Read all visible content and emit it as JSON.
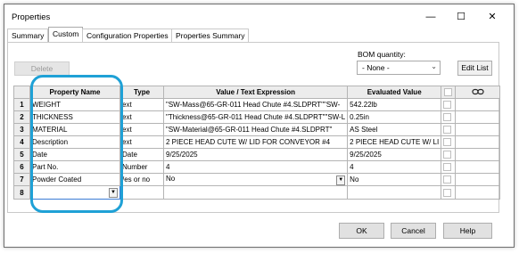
{
  "window": {
    "title": "Properties",
    "minimize": "—",
    "maximize": "☐",
    "close": "✕"
  },
  "tabs": [
    {
      "label": "Summary"
    },
    {
      "label": "Custom"
    },
    {
      "label": "Configuration Properties"
    },
    {
      "label": "Properties Summary"
    }
  ],
  "toolbar": {
    "delete_label": "Delete",
    "bom_label": "BOM quantity:",
    "bom_value": "- None -",
    "edit_list_label": "Edit List"
  },
  "table": {
    "headers": [
      "Property Name",
      "Type",
      "Value / Text Expression",
      "Evaluated Value"
    ],
    "link_icon": "link-icon",
    "rows": [
      {
        "num": "1",
        "name": "WEIGHT",
        "type": "ext",
        "value": "\"SW-Mass@65-GR-011 Head Chute #4.SLDPRT\"\"SW-",
        "evaluated": "542.22lb"
      },
      {
        "num": "2",
        "name": "THICKNESS",
        "type": "ext",
        "value": "\"Thickness@65-GR-011 Head Chute #4.SLDPRT\"\"SW-L",
        "evaluated": "0.25in"
      },
      {
        "num": "3",
        "name": "MATERIAL",
        "type": "ext",
        "value": "\"SW-Material@65-GR-011 Head Chute #4.SLDPRT\"",
        "evaluated": "AS Steel"
      },
      {
        "num": "4",
        "name": "Description",
        "type": "ext",
        "value": "2 PIECE HEAD CUTE W/ LID FOR CONVEYOR #4",
        "evaluated": "2 PIECE HEAD CUTE W/ LI"
      },
      {
        "num": "5",
        "name": "Date",
        "type": "Date",
        "value": "9/25/2025",
        "evaluated": "9/25/2025"
      },
      {
        "num": "6",
        "name": "Part No.",
        "type": "Number",
        "value": "4",
        "evaluated": "4"
      },
      {
        "num": "7",
        "name": "Powder Coated",
        "type": "/es or no",
        "value": "No",
        "evaluated": "No"
      },
      {
        "num": "8",
        "name": "",
        "type": "",
        "value": "",
        "evaluated": ""
      }
    ]
  },
  "footer": {
    "ok": "OK",
    "cancel": "Cancel",
    "help": "Help"
  },
  "colors": {
    "highlight": "#1fa1d6",
    "accent": "#3a7bd5"
  }
}
